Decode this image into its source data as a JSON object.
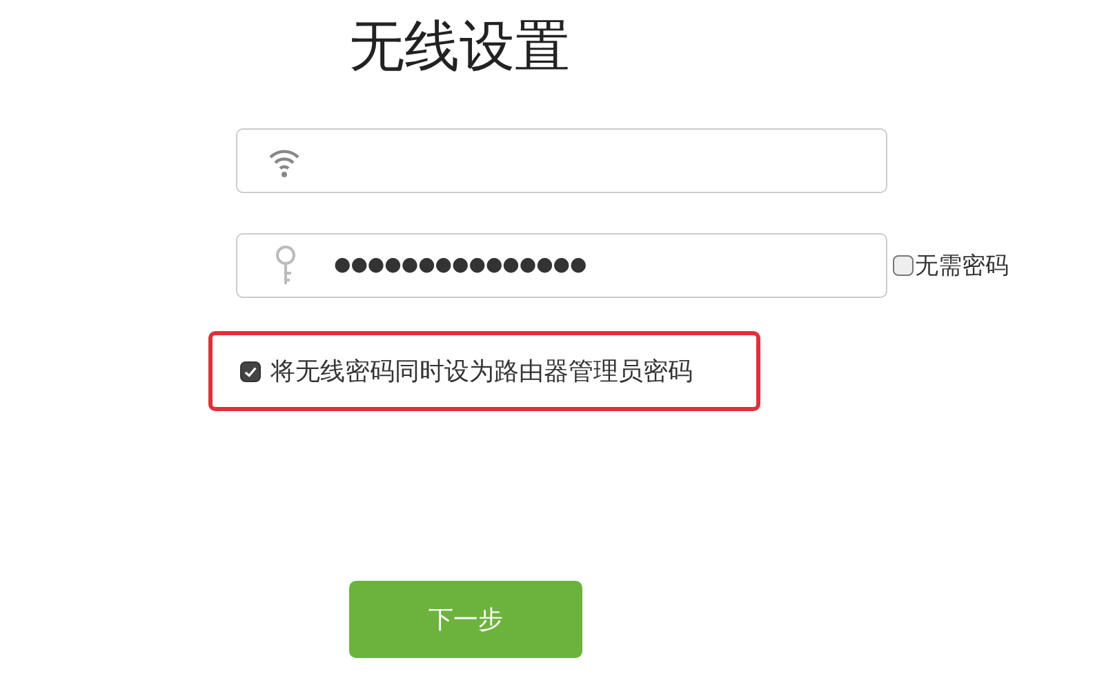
{
  "title": "无线设置",
  "password_field": {
    "value": "●●●●●●●●●●●●●●●"
  },
  "no_password": {
    "label": "无需密码",
    "checked": false
  },
  "same_admin_password": {
    "label": "将无线密码同时设为路由器管理员密码",
    "checked": true,
    "highlighted": true
  },
  "next_button": {
    "label": "下一步"
  }
}
